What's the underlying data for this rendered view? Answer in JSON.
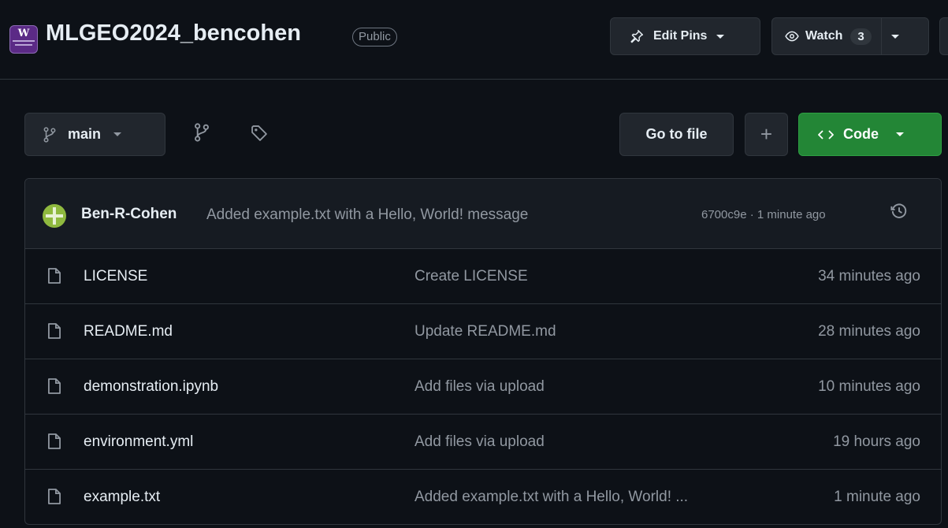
{
  "repo": {
    "name": "MLGEO2024_bencohen",
    "visibility": "Public",
    "avatar_letter": "W"
  },
  "header_actions": {
    "edit_pins_label": "Edit Pins",
    "watch_label": "Watch",
    "watch_count": "3"
  },
  "toolbar": {
    "branch": "main",
    "goto_file_label": "Go to file",
    "add_label": "+",
    "code_label": "Code"
  },
  "latest_commit": {
    "author": "Ben-R-Cohen",
    "message": "Added example.txt with a Hello, World! message",
    "meta": "6700c9e · 1 minute ago"
  },
  "files": [
    {
      "name": "LICENSE",
      "message": "Create LICENSE",
      "time": "34 minutes ago"
    },
    {
      "name": "README.md",
      "message": "Update README.md",
      "time": "28 minutes ago"
    },
    {
      "name": "demonstration.ipynb",
      "message": "Add files via upload",
      "time": "10 minutes ago"
    },
    {
      "name": "environment.yml",
      "message": "Add files via upload",
      "time": "19 hours ago"
    },
    {
      "name": "example.txt",
      "message": "Added example.txt with a Hello, World! ...",
      "time": "1 minute ago"
    }
  ],
  "colors": {
    "background": "#0d1117",
    "code_button": "#238636"
  }
}
